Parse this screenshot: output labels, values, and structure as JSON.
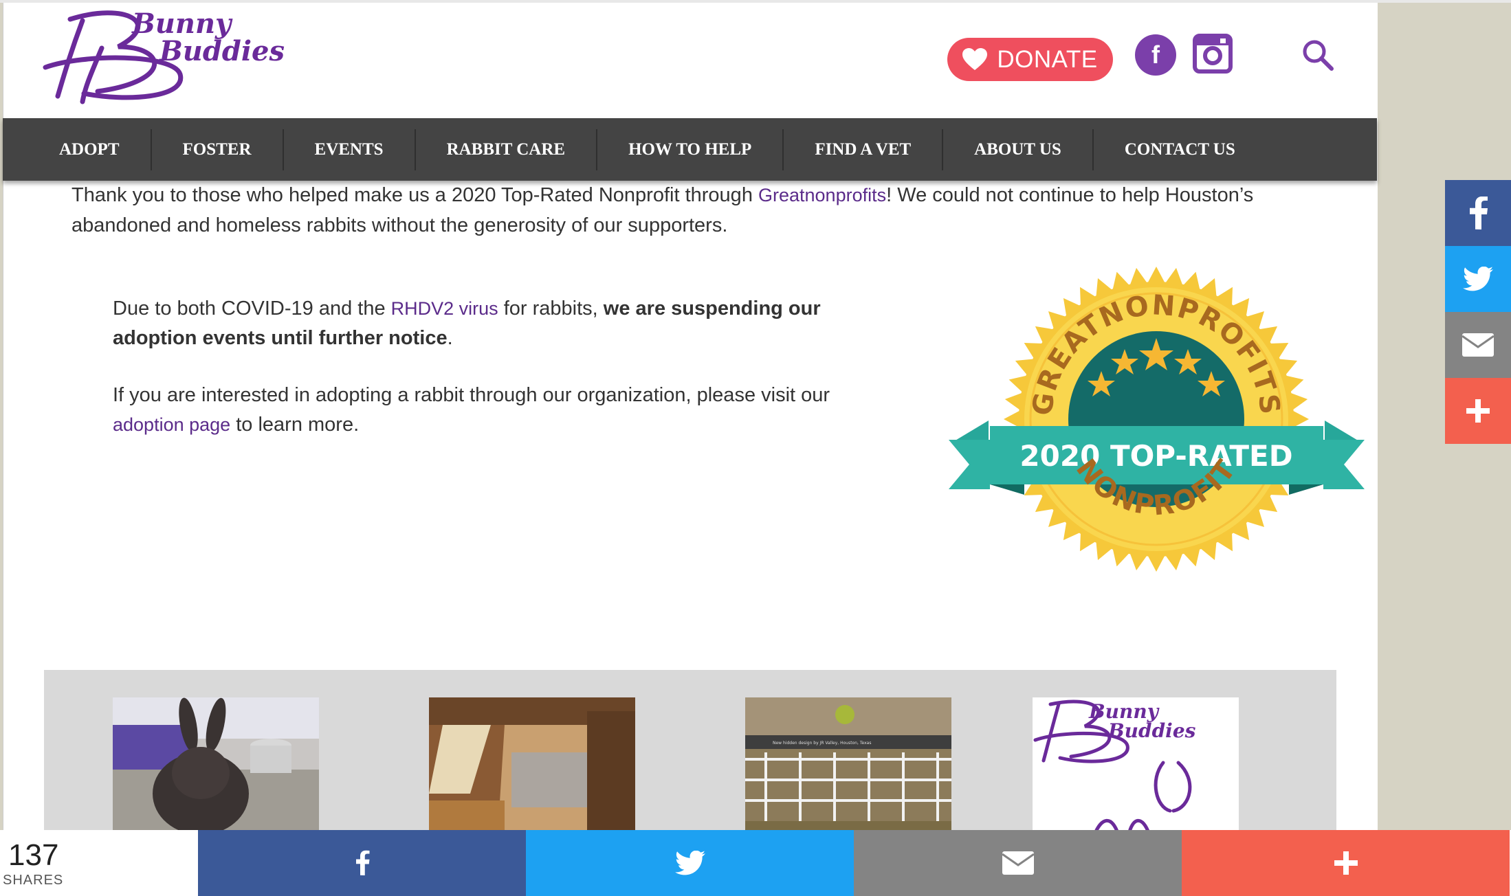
{
  "header": {
    "logo_text_line1": "Bunny",
    "logo_text_line2": "Buddies",
    "donate_label": "DONATE",
    "icons": {
      "heart": "heart-icon",
      "facebook": "facebook-icon",
      "instagram": "instagram-icon",
      "search": "search-icon"
    }
  },
  "nav": {
    "items": [
      {
        "label": "ADOPT"
      },
      {
        "label": "FOSTER"
      },
      {
        "label": "EVENTS"
      },
      {
        "label": "RABBIT CARE"
      },
      {
        "label": "HOW TO HELP"
      },
      {
        "label": "FIND A VET"
      },
      {
        "label": "ABOUT US"
      },
      {
        "label": "CONTACT US"
      }
    ]
  },
  "intro": {
    "text_before": "Thank you to those who helped make us a 2020 Top-Rated Nonprofit through ",
    "link": "Greatnonprofits",
    "text_after": "! We could not continue to help Houston’s abandoned and homeless rabbits without the generosity of our supporters."
  },
  "notice": {
    "p1_before": "Due to both COVID-19 and the ",
    "p1_link": "RHDV2 virus",
    "p1_mid": " for rabbits, ",
    "p1_bold": "we are suspending our adoption events until further notice",
    "p1_end": ".",
    "p2_before": "If you are interested in adopting a rabbit through our organization, please visit our ",
    "p2_link": "adoption page",
    "p2_after": " to learn more."
  },
  "badge": {
    "arc_top": "GREATNONPROFITS",
    "ribbon": "2020 TOP-RATED",
    "arc_bottom": "NONPROFIT"
  },
  "gallery": {
    "logo_line1": "Bunny",
    "logo_line2": "Buddies",
    "caption": "New hidden design by JR Valley, Houston, Texas"
  },
  "share": {
    "count": "137",
    "label": "SHARES",
    "icons": [
      "facebook-icon",
      "twitter-icon",
      "email-icon",
      "plus-icon"
    ],
    "colors": {
      "facebook": "#3b5998",
      "twitter": "#1da1f2",
      "email": "#848484",
      "plus": "#f3604e"
    }
  },
  "colors": {
    "brand_purple": "#5b2b8a",
    "nav_bg": "#444444",
    "donate": "#ef4f5e"
  }
}
